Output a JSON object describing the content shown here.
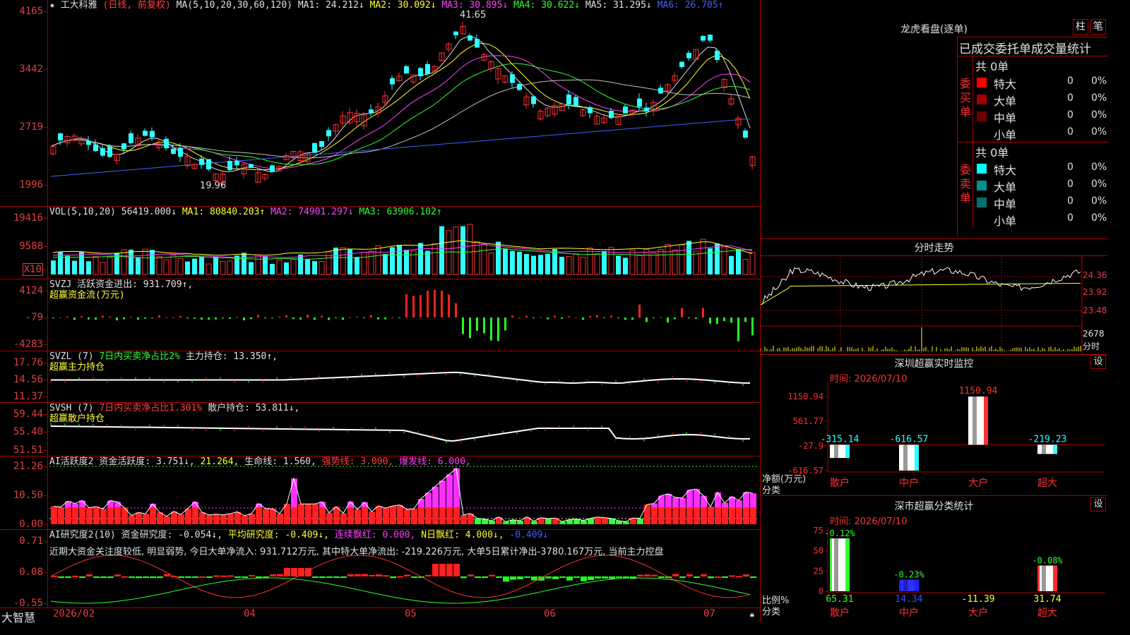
{
  "stock": {
    "name": "工大科雅",
    "period": "(日线, 前复权)",
    "ma_label": "MA(5,10,20,30,60,120)",
    "ma1": "MA1: 24.212↓",
    "ma2": "MA2: 30.092↓",
    "ma3": "MA3: 30.895↓",
    "ma4": "MA4: 30.622↓",
    "ma5": "MA5: 31.295↓",
    "ma6": "MA6: 26.705↑",
    "high_label": "41.65",
    "low_label": "19.96",
    "price_ticks": [
      "4165",
      "3442",
      "2719",
      "1996"
    ]
  },
  "vol": {
    "label": "VOL(5,10,20)",
    "value": "56419.000↓",
    "ma1": "MA1: 80840.203↑",
    "ma2": "MA2: 74901.297↓",
    "ma3": "MA3: 63906.102↑",
    "ticks": [
      "19416",
      "9588"
    ],
    "unit": "X10"
  },
  "svzj": {
    "label": "SVZJ",
    "metric": "活跃资金进出: 931.709↑,",
    "sub": "超赢资金流(万元)",
    "ticks": [
      "4124",
      "-79",
      "-4283"
    ]
  },
  "svzl": {
    "label": "SVZL (7)",
    "metric1": "7日内买卖净占比2%",
    "metric2": "主力持仓: 13.350↑,",
    "sub": "超赢主力持仓",
    "ticks": [
      "17.76",
      "14.56",
      "11.37"
    ]
  },
  "svsh": {
    "label": "SVSH (7)",
    "metric1": "7日内买卖净占比1.301%",
    "metric2": "散户持仓: 53.811↓,",
    "sub": "超赢散户持仓",
    "ticks": [
      "59.44",
      "55.40",
      "51.51"
    ]
  },
  "ai1": {
    "label": "AI活跃度2",
    "m1": "资金活跃度: 3.751↓,",
    "m2": "21.264,",
    "m3": "生命线: 1.560,",
    "m4": "强势线: 3.000,",
    "m5": "爆发线: 6.000,",
    "ticks": [
      "21.26",
      "10.50",
      "0.00"
    ]
  },
  "ai2": {
    "label": "AI研究度2(10)",
    "m1": "资金研究度: -0.054↓,",
    "m2": "平均研究度: -0.409↓,",
    "m3": "连续飘红: 0.000,",
    "m4": "N日飘红: 4.000↓,",
    "m5": "-0.409↓",
    "desc": "近期大资金关注度较低, 明显弱势, 今日大单净流入: 931.712万元, 其中特大单净流出: -219.226万元, 大单5日累计净出-3780.167万元, 当前主力控盘",
    "ticks": [
      "0.71",
      "0.08",
      "-0.55"
    ]
  },
  "xaxis": {
    "brand": "大智慧",
    "labels": [
      "2026/02",
      "04",
      "05",
      "06",
      "07"
    ]
  },
  "dragon": {
    "title": "龙虎看盘(逐单)",
    "btn1": "柱",
    "btn2": "笔",
    "header": "已成交委托单成交量统计",
    "buy_side": "委买单",
    "sell_side": "委卖单",
    "buy_total": "共 0单",
    "sell_total": "共 0单",
    "buy_rows": [
      {
        "name": "特大",
        "val": "0",
        "pct": "0%",
        "color": "#ff0000"
      },
      {
        "name": "大单",
        "val": "0",
        "pct": "0%",
        "color": "#a00000"
      },
      {
        "name": "中单",
        "val": "0",
        "pct": "0%",
        "color": "#700000"
      },
      {
        "name": "小单",
        "val": "0",
        "pct": "0%",
        "color": ""
      }
    ],
    "sell_rows": [
      {
        "name": "特大",
        "val": "0",
        "pct": "0%",
        "color": "#00ffff"
      },
      {
        "name": "大单",
        "val": "0",
        "pct": "0%",
        "color": "#009090"
      },
      {
        "name": "中单",
        "val": "0",
        "pct": "0%",
        "color": "#007070"
      },
      {
        "name": "小单",
        "val": "0",
        "pct": "0%",
        "color": ""
      }
    ]
  },
  "intraday": {
    "title": "分时走势",
    "ticks": [
      "24.36",
      "23.92",
      "23.48"
    ],
    "vol_tick": "2678",
    "vol_label": "分时"
  },
  "sz_monitor": {
    "title": "深圳超赢实时监控",
    "set": "设",
    "time": "时间: 2026/07/10",
    "ylabel": "净额(万元)",
    "xlabel": "分类",
    "ticks": [
      "1150.94",
      "561.77",
      "-27.9",
      "-616.57"
    ],
    "categories": [
      "散户",
      "中户",
      "大户",
      "超大"
    ],
    "values": [
      -315.14,
      -616.57,
      1150.94,
      -219.23
    ],
    "value_labels": [
      "-315.14",
      "-616.57",
      "1150.94",
      "-219.23"
    ]
  },
  "sz_class": {
    "title": "深市超赢分类统计",
    "set": "设",
    "time": "时间: 2026/07/10",
    "ylabel": "比例%",
    "xlabel": "分类",
    "ticks": [
      "75",
      "50",
      "25",
      "0"
    ],
    "categories": [
      "散户",
      "中户",
      "大户",
      "超大"
    ],
    "top_labels": [
      "-0.12%",
      "-0.23%",
      "",
      "-0.08%"
    ],
    "bottom_labels": [
      "65.31",
      "14.34",
      "-11.39",
      "31.74"
    ],
    "values": [
      65.31,
      14.34,
      0,
      31.74
    ]
  },
  "chart_data": [
    {
      "type": "bar",
      "title": "深圳超赢实时监控",
      "categories": [
        "散户",
        "中户",
        "大户",
        "超大"
      ],
      "values": [
        -315.14,
        -616.57,
        1150.94,
        -219.23
      ],
      "xlabel": "分类",
      "ylabel": "净额(万元)",
      "ylim": [
        -616.57,
        1150.94
      ]
    },
    {
      "type": "bar",
      "title": "深市超赢分类统计",
      "categories": [
        "散户",
        "中户",
        "大户",
        "超大"
      ],
      "values": [
        65.31,
        14.34,
        -11.39,
        31.74
      ],
      "xlabel": "分类",
      "ylabel": "比例%",
      "ylim": [
        0,
        75
      ]
    }
  ]
}
